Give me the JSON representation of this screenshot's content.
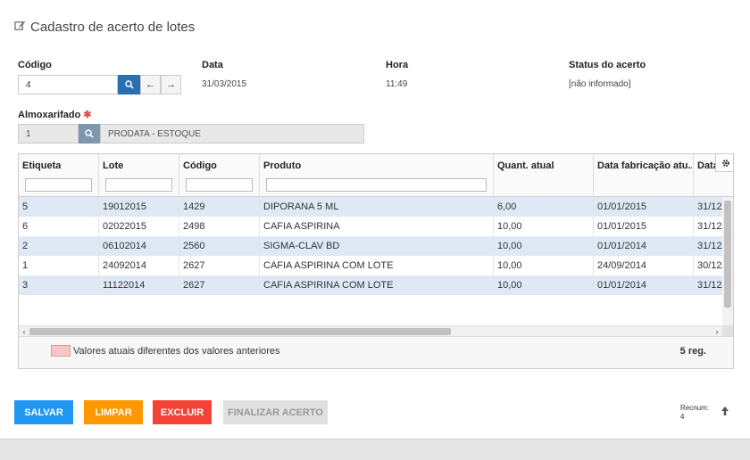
{
  "page": {
    "title": "Cadastro de acerto de lotes"
  },
  "fields": {
    "codigo": {
      "label": "Código",
      "value": "4"
    },
    "data": {
      "label": "Data",
      "value": "31/03/2015"
    },
    "hora": {
      "label": "Hora",
      "value": "11:49"
    },
    "status": {
      "label": "Status do acerto",
      "value": "[não informado]"
    },
    "almoxarifado": {
      "label": "Almoxarifado",
      "code": "1",
      "name": "PRODATA - ESTOQUE"
    }
  },
  "grid": {
    "columns": [
      "Etiqueta",
      "Lote",
      "Código",
      "Produto",
      "Quant. atual",
      "Data fabricação atu...",
      "Data"
    ],
    "rows": [
      [
        "5",
        "19012015",
        "1429",
        "DIPORANA 5 ML",
        "6,00",
        "01/01/2015",
        "31/12/"
      ],
      [
        "6",
        "02022015",
        "2498",
        "CAFIA ASPIRINA",
        "10,00",
        "01/01/2015",
        "31/12/"
      ],
      [
        "2",
        "06102014",
        "2560",
        "SIGMA-CLAV BD",
        "10,00",
        "01/01/2014",
        "31/12/"
      ],
      [
        "1",
        "24092014",
        "2627",
        "CAFIA ASPIRINA COM LOTE",
        "10,00",
        "24/09/2014",
        "30/12/"
      ],
      [
        "3",
        "11122014",
        "2627",
        "CAFIA ASPIRINA COM LOTE",
        "10,00",
        "01/01/2014",
        "31/12/"
      ]
    ],
    "legend": "Valores atuais diferentes dos valores anteriores",
    "count": "5 reg.",
    "legend_color": "#f7c7c7",
    "row_alt_color": "#dfe9f5"
  },
  "buttons": {
    "salvar": "SALVAR",
    "limpar": "LIMPAR",
    "excluir": "EXCLUIR",
    "finalizar": "FINALIZAR ACERTO"
  },
  "recnum": {
    "label": "Recnum:",
    "value": "4"
  },
  "colors": {
    "primary": "#2196f3",
    "warning": "#ff9800",
    "danger": "#f44336",
    "search": "#2a6fb0"
  }
}
